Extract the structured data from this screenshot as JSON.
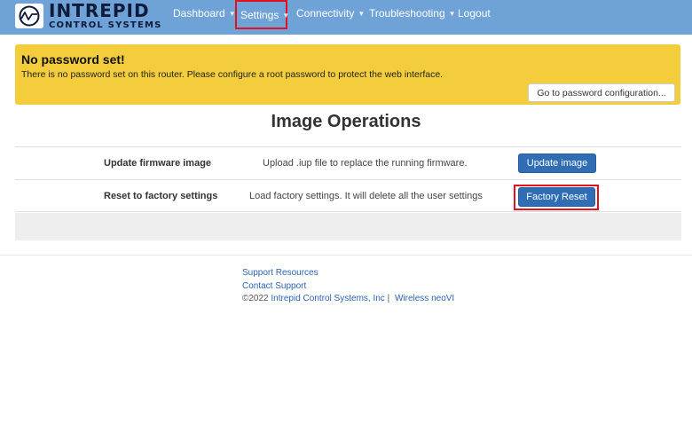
{
  "brand": {
    "name_top": "INTREPID",
    "name_bottom": "CONTROL SYSTEMS"
  },
  "nav": {
    "items": [
      {
        "label": "Dashboard",
        "dropdown": true
      },
      {
        "label": "Settings",
        "dropdown": true,
        "highlighted": true
      },
      {
        "label": "Connectivity",
        "dropdown": true
      },
      {
        "label": "Troubleshooting",
        "dropdown": true
      },
      {
        "label": "Logout",
        "dropdown": false
      }
    ]
  },
  "alert": {
    "title": "No password set!",
    "message": "There is no password set on this router. Please configure a root password to protect the web interface.",
    "button_label": "Go to password configuration..."
  },
  "page": {
    "title": "Image Operations"
  },
  "operations": [
    {
      "label": "Update firmware image",
      "description": "Upload .iup file to replace the running firmware.",
      "button_label": "Update image"
    },
    {
      "label": "Reset to factory settings",
      "description": "Load factory settings. It will delete all the user settings",
      "button_label": "Factory Reset",
      "highlighted": true
    }
  ],
  "footer": {
    "support_resources": "Support Resources",
    "contact_support": "Contact Support",
    "copyright": "©2022",
    "company_link": "Intrepid Control Systems, Inc",
    "separator": "|",
    "product_link": "Wireless neoVI"
  },
  "colors": {
    "navbar": "#6fa2d6",
    "alert": "#f4cd3c",
    "primary_button": "#2f6db5",
    "highlight": "#e3101e",
    "link": "#2a64b0"
  },
  "icons": {
    "logo": "intrepid-logo-icon",
    "dropdown": "caret-down-icon"
  }
}
